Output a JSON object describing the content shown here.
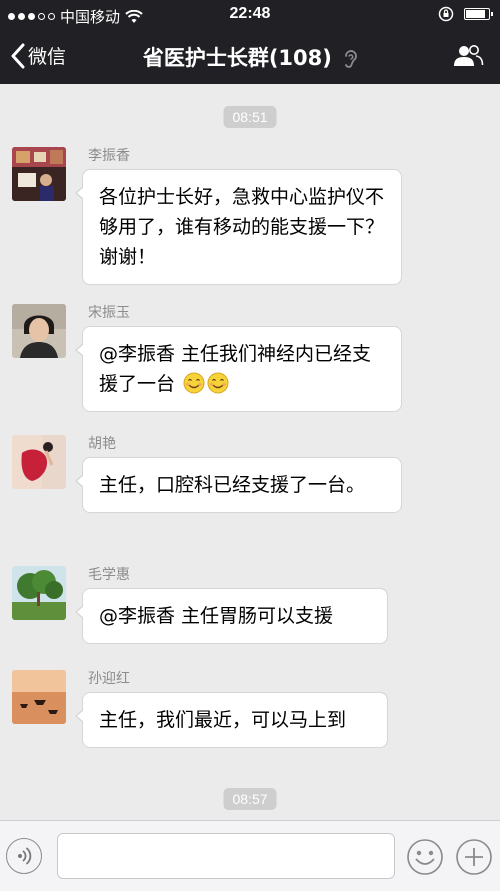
{
  "status_bar": {
    "carrier": "中国移动",
    "time": "22:48",
    "signal_bars": 3,
    "battery_level": 0.9
  },
  "nav": {
    "back_label": "微信",
    "title": "省医护士长群(108)"
  },
  "timestamps": [
    "08:51",
    "08:57"
  ],
  "messages": [
    {
      "sender": "李振香",
      "text": "各位护士长好，急救中心监护仪不够用了，谁有移动的能支援一下？谢谢！"
    },
    {
      "sender": "宋振玉",
      "text": "@李振香 主任我们神经内已经支援了一台",
      "emoji": [
        "smile-emoji",
        "smile-emoji"
      ]
    },
    {
      "sender": "胡艳",
      "text": "主任，口腔科已经支援了一台。"
    },
    {
      "sender": "毛学惠",
      "text": "@李振香  主任胃肠可以支援"
    },
    {
      "sender": "孙迎红",
      "text": "主任，我们最近，可以马上到"
    }
  ],
  "icons": {
    "back": "chevron-left-icon",
    "ear": "ear-icon",
    "members": "group-members-icon",
    "voice": "voice-input-icon",
    "emoji": "emoji-smile-icon",
    "more": "plus-icon"
  },
  "colors": {
    "nav_bg": "#212125",
    "chat_bg": "#ebebeb",
    "bubble_bg": "#ffffff",
    "timestamp_bg": "#cecece"
  }
}
